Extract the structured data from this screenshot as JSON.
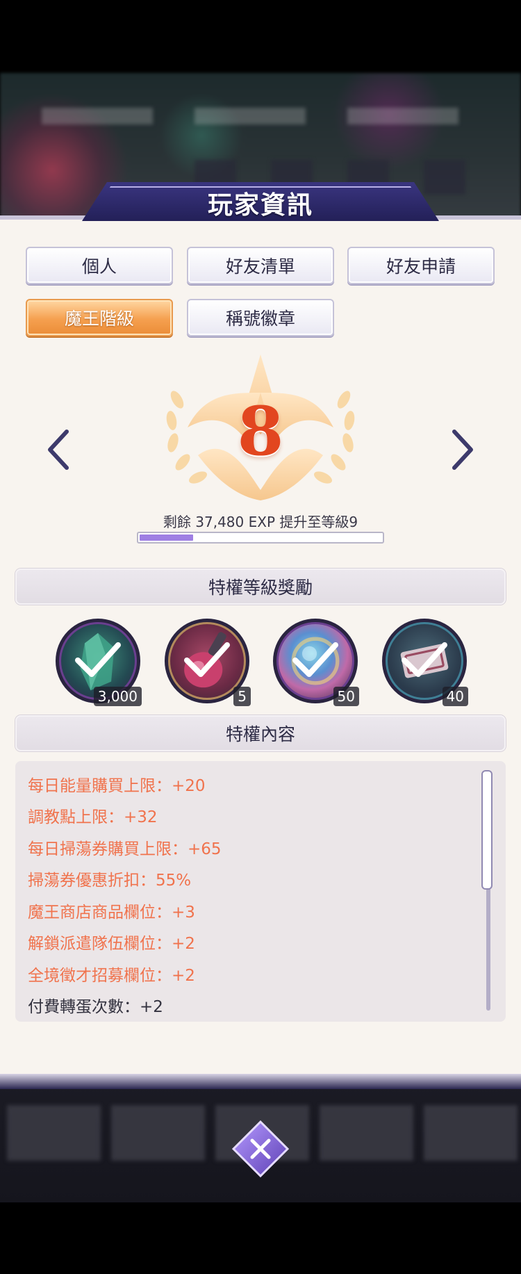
{
  "title": "玩家資訊",
  "tabs": [
    {
      "label": "個人",
      "active": false
    },
    {
      "label": "好友清單",
      "active": false
    },
    {
      "label": "好友申請",
      "active": false
    },
    {
      "label": "魔王階級",
      "active": true
    },
    {
      "label": "稱號徽章",
      "active": false
    }
  ],
  "level": {
    "value": "8",
    "exp_text": "剩餘 37,480 EXP 提升至等級9",
    "progress": 0.22
  },
  "rewards_section": {
    "title": "特權等級獎勵",
    "items": [
      {
        "icon": "green-crystal-icon",
        "qty": "3,000",
        "claimed": true
      },
      {
        "icon": "potion-flask-icon",
        "qty": "5",
        "claimed": true
      },
      {
        "icon": "rainbow-orb-icon",
        "qty": "50",
        "claimed": true
      },
      {
        "icon": "ticket-icon",
        "qty": "40",
        "claimed": true
      }
    ]
  },
  "privileges_section": {
    "title": "特權內容",
    "items": [
      {
        "text": "每日能量購買上限：+20",
        "highlight": true
      },
      {
        "text": "調教點上限：+32",
        "highlight": true
      },
      {
        "text": "每日掃蕩券購買上限：+65",
        "highlight": true
      },
      {
        "text": "掃蕩券優惠折扣：55%",
        "highlight": true
      },
      {
        "text": "魔王商店商品欄位：+3",
        "highlight": true
      },
      {
        "text": "解鎖派遣隊伍欄位：+2",
        "highlight": true
      },
      {
        "text": "全境徵才招募欄位：+2",
        "highlight": true
      },
      {
        "text": "付費轉蛋次數：+2",
        "highlight": false
      }
    ]
  },
  "colors": {
    "accent_orange": "#f0734d",
    "active_tab": "#f5a04f",
    "title_bar": "#2a2660",
    "exp_fill": "#9f7fe3"
  }
}
